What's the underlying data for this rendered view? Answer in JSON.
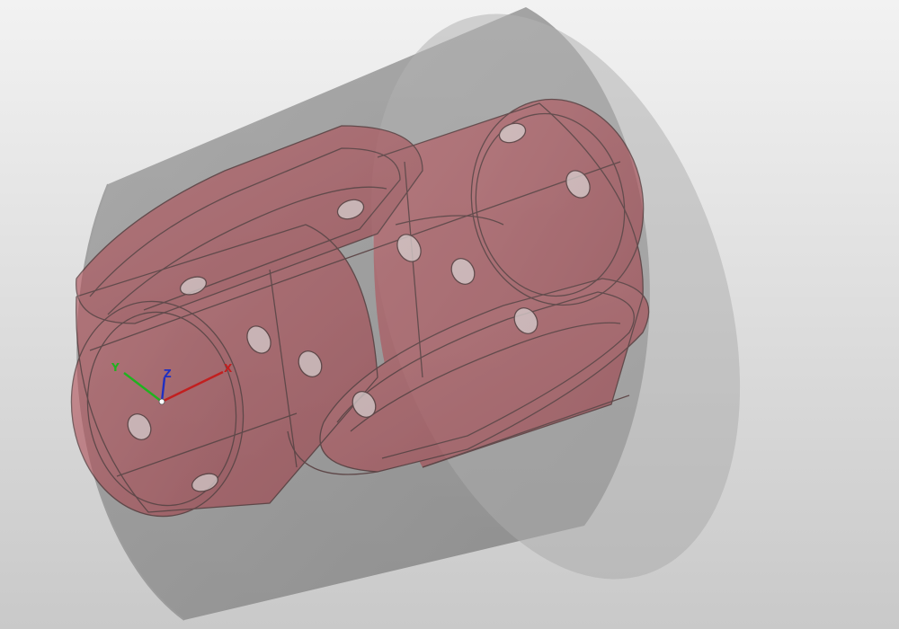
{
  "viewport": {
    "background_top": "#f2f2f2",
    "background_bottom": "#c9c9c9"
  },
  "stock": {
    "color": "#8a8a8a",
    "opacity": 0.78
  },
  "part": {
    "fill": "#a8454e",
    "opacity": 0.62,
    "edge": "#3a1518"
  },
  "triad": {
    "x_label": "X",
    "y_label": "Y",
    "z_label": "Z",
    "x_color": "#c21f1f",
    "y_color": "#1fb31f",
    "z_color": "#1f2fc2"
  }
}
